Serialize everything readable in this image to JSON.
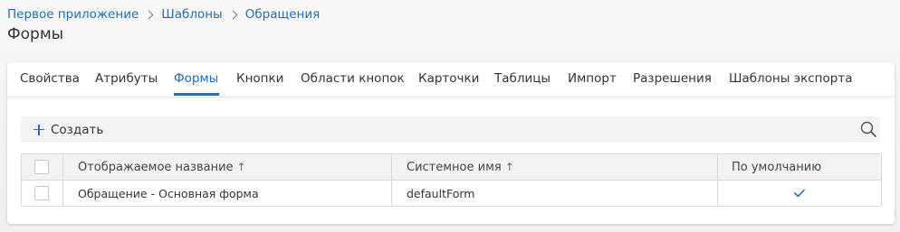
{
  "breadcrumb": {
    "items": [
      "Первое приложение",
      "Шаблоны",
      "Обращения"
    ]
  },
  "page": {
    "title": "Формы"
  },
  "tabs": [
    {
      "label": "Свойства"
    },
    {
      "label": "Атрибуты"
    },
    {
      "label": "Формы"
    },
    {
      "label": "Кнопки"
    },
    {
      "label": "Области кнопок"
    },
    {
      "label": "Карточки"
    },
    {
      "label": "Таблицы"
    },
    {
      "label": "Импорт"
    },
    {
      "label": "Разрешения"
    },
    {
      "label": "Шаблоны экспорта"
    }
  ],
  "active_tab": "Формы",
  "toolbar": {
    "create_label": "Создать",
    "search_icon": "search-icon"
  },
  "table": {
    "columns": [
      "Отображаемое название",
      "Системное имя",
      "По умолчанию"
    ],
    "sort_arrow": "↑",
    "rows": [
      {
        "display_name": "Обращение - Основная форма",
        "system_name": "defaultForm",
        "is_default": "✓"
      }
    ]
  },
  "colors": {
    "accent": "#1f6fb2",
    "text": "#333333",
    "toolbar_bg": "#f3f3f3",
    "border": "#d9d9d9"
  }
}
